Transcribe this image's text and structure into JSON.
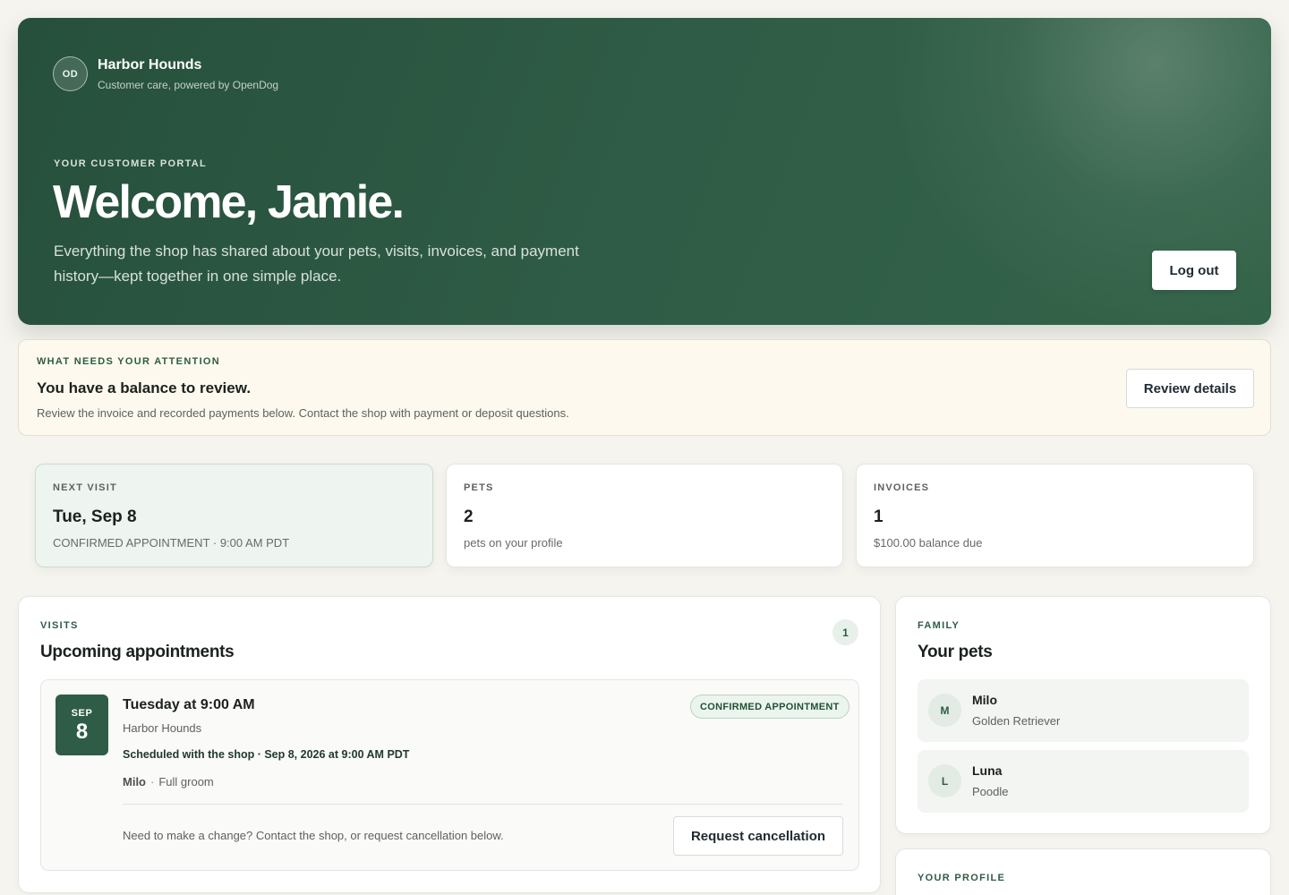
{
  "brand": {
    "initials": "OD",
    "name": "Harbor Hounds",
    "subtitle": "Customer care, powered by OpenDog"
  },
  "hero": {
    "eyebrow": "YOUR CUSTOMER PORTAL",
    "title": "Welcome, Jamie.",
    "description": "Everything the shop has shared about your pets, visits, invoices, and payment history—kept together in one simple place.",
    "logout_label": "Log out"
  },
  "attention": {
    "eyebrow": "WHAT NEEDS YOUR ATTENTION",
    "title": "You have a balance to review.",
    "description": "Review the invoice and recorded payments below. Contact the shop with payment or deposit questions.",
    "button_label": "Review details"
  },
  "stats": [
    {
      "label": "NEXT VISIT",
      "value": "Tue, Sep 8",
      "note": "CONFIRMED APPOINTMENT · 9:00 AM PDT"
    },
    {
      "label": "PETS",
      "value": "2",
      "note": "pets on your profile"
    },
    {
      "label": "INVOICES",
      "value": "1",
      "note": "$100.00 balance due"
    }
  ],
  "visits": {
    "eyebrow": "VISITS",
    "title": "Upcoming appointments",
    "count": "1",
    "appointment": {
      "month": "SEP",
      "day": "8",
      "time": "Tuesday at 9:00 AM",
      "shop": "Harbor Hounds",
      "scheduled": "Scheduled with the shop · Sep 8, 2026 at 9:00 AM PDT",
      "pet": "Milo",
      "separator": "·",
      "service": "Full groom",
      "status": "CONFIRMED APPOINTMENT",
      "help": "Need to make a change? Contact the shop, or request cancellation below.",
      "cancel_label": "Request cancellation"
    }
  },
  "family": {
    "eyebrow": "FAMILY",
    "title": "Your pets",
    "pets": [
      {
        "initial": "M",
        "name": "Milo",
        "breed": "Golden Retriever"
      },
      {
        "initial": "L",
        "name": "Luna",
        "breed": "Poodle"
      }
    ]
  },
  "profile": {
    "eyebrow": "YOUR PROFILE"
  },
  "colors": {
    "brand_green": "#2f5c46",
    "page_background": "#f6f4ef",
    "attention_background": "#fdf9ee",
    "highlight_background": "#eef5f0"
  }
}
